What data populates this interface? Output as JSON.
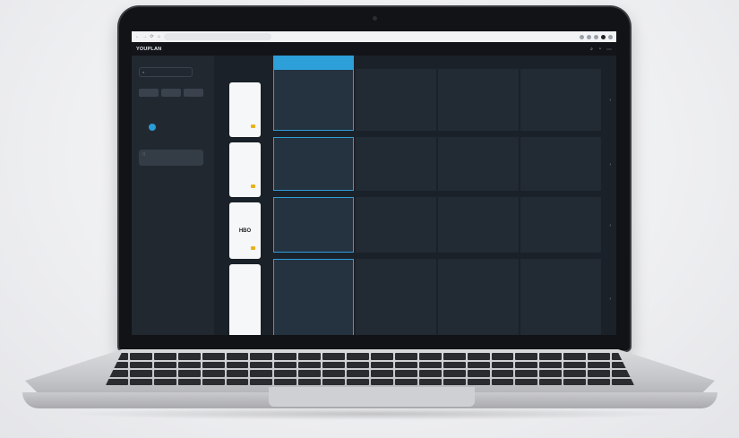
{
  "browser": {
    "address": "",
    "nav_icons": [
      "←",
      "→",
      "⟳",
      "⌂"
    ]
  },
  "appnav": {
    "logo": "YOUPLAN",
    "items": [
      "",
      "",
      "",
      "",
      "",
      ""
    ],
    "user": ""
  },
  "sidebar": {
    "top_label": "",
    "search_placeholder": "",
    "views": [
      "",
      "",
      ""
    ],
    "month": "",
    "calendar": {
      "days": [
        "",
        "",
        "",
        "",
        "",
        "",
        "",
        "",
        "",
        "",
        "",
        "",
        "",
        "",
        "",
        "",
        "",
        "",
        "",
        "",
        "",
        "",
        "",
        "",
        "",
        "",
        "",
        "",
        "",
        "",
        "",
        "",
        "",
        "",
        ""
      ],
      "today_index": 22
    },
    "filter_label": "",
    "filter_text": ""
  },
  "channels": [
    {
      "name": "",
      "icon": "tv-logo-icon"
    },
    {
      "name": "",
      "icon": "tv-logo-icon"
    },
    {
      "name": "HBO",
      "icon": "tv-logo-icon"
    },
    {
      "name": "",
      "icon": "tv-logo-icon"
    }
  ],
  "grid": {
    "columns": [
      {
        "time": "",
        "active": true
      },
      {
        "time": "",
        "active": false
      },
      {
        "time": "",
        "active": false
      },
      {
        "time": "",
        "active": false
      }
    ],
    "rows": [
      [
        [
          ""
        ],
        [
          ""
        ],
        [
          ""
        ],
        [
          ""
        ]
      ],
      [
        [
          ""
        ],
        [
          ""
        ],
        [
          ""
        ],
        [
          ""
        ]
      ],
      [
        [
          ""
        ],
        [
          ""
        ],
        [
          ""
        ],
        [
          ""
        ]
      ],
      [
        [
          ""
        ],
        [
          ""
        ],
        [
          ""
        ],
        [
          ""
        ]
      ]
    ]
  },
  "colors": {
    "accent": "#2d9fd9",
    "background": "#1b2129",
    "sidebar": "#222830"
  }
}
